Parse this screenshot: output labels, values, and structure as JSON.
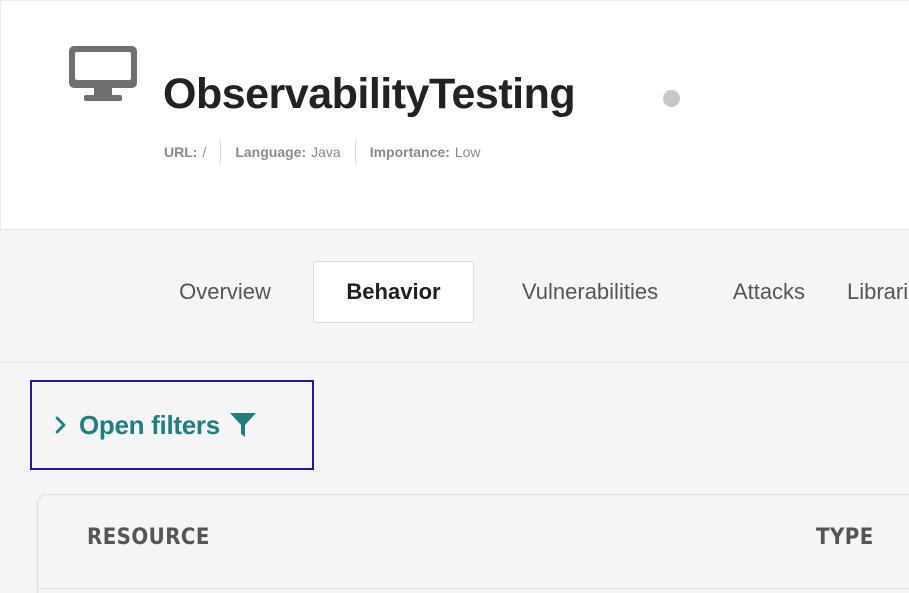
{
  "app": {
    "title": "ObservabilityTesting",
    "icon": "desktop-monitor-icon",
    "status_dot_color": "#c7c7c7",
    "meta": [
      {
        "label": "URL:",
        "value": "/"
      },
      {
        "label": "Language:",
        "value": "Java"
      },
      {
        "label": "Importance:",
        "value": "Low"
      }
    ]
  },
  "tabs": [
    {
      "label": "Overview",
      "active": false
    },
    {
      "label": "Behavior",
      "active": true
    },
    {
      "label": "Vulnerabilities",
      "active": false
    },
    {
      "label": "Attacks",
      "active": false
    },
    {
      "label": "Libraries",
      "active": false
    }
  ],
  "filters": {
    "label": "Open filters",
    "chevron_icon": "chevron-right-icon",
    "filter_icon": "funnel-icon",
    "accent_color": "#1f7f80"
  },
  "table": {
    "columns": [
      "RESOURCE",
      "TYPE"
    ]
  },
  "colors": {
    "accent": "#1f7f80",
    "focus_outline": "#1a1aa6",
    "band_background": "#f5f5f5"
  }
}
